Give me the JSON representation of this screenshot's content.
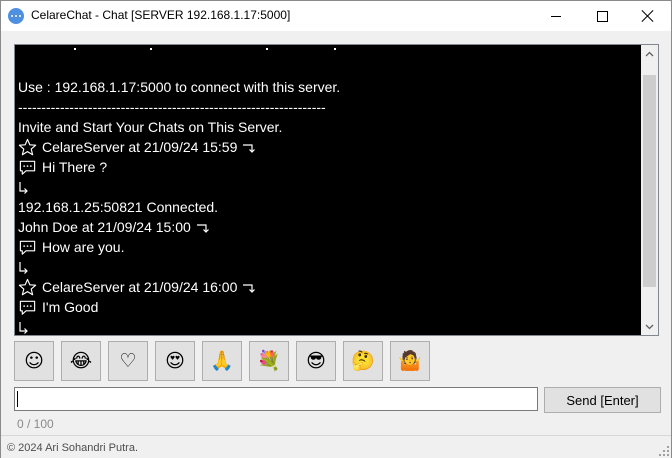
{
  "window": {
    "title": "CelareChat - Chat [SERVER 192.168.1.17:5000]"
  },
  "chat": {
    "lines": [
      {
        "icon": "",
        "text": "",
        "partial": true
      },
      {
        "icon": "",
        "text": ""
      },
      {
        "icon": "",
        "text": "Use : 192.168.1.17:5000 to connect with this server."
      },
      {
        "icon": "",
        "text": "------------------------------------------------------------------"
      },
      {
        "icon": "",
        "text": "Invite and Start Your Chats on This Server."
      },
      {
        "icon": "star-icon",
        "text": "CelareServer at 21/09/24 15:59",
        "return": true
      },
      {
        "icon": "speech-bubble-icon",
        "text": "Hi There ?"
      },
      {
        "icon": "reply-arrow-icon",
        "text": ""
      },
      {
        "icon": "",
        "text": "192.168.1.25:50821 Connected."
      },
      {
        "icon": "",
        "text": "John Doe at 21/09/24 15:00",
        "return": true
      },
      {
        "icon": "speech-bubble-icon",
        "text": "How are you."
      },
      {
        "icon": "reply-arrow-icon",
        "text": ""
      },
      {
        "icon": "star-icon",
        "text": "CelareServer at 21/09/24 16:00",
        "return": true
      },
      {
        "icon": "speech-bubble-icon",
        "text": "I'm Good"
      },
      {
        "icon": "reply-arrow-icon",
        "text": ""
      }
    ]
  },
  "emoji_buttons": [
    {
      "glyph": "☺",
      "name": "smiling-face-emoji-button"
    },
    {
      "glyph": "😂",
      "name": "tears-of-joy-emoji-button"
    },
    {
      "glyph": "♡",
      "name": "heart-emoji-button"
    },
    {
      "glyph": "😍",
      "name": "heart-eyes-emoji-button"
    },
    {
      "glyph": "🙏",
      "name": "folded-hands-emoji-button"
    },
    {
      "glyph": "💐",
      "name": "bouquet-emoji-button"
    },
    {
      "glyph": "😎",
      "name": "sunglasses-emoji-button"
    },
    {
      "glyph": "🤔",
      "name": "thinking-face-emoji-button"
    },
    {
      "glyph": "🤷",
      "name": "shrug-emoji-button"
    }
  ],
  "input": {
    "value": "",
    "placeholder": ""
  },
  "send_label": "Send [Enter]",
  "char_counter": "0 / 100",
  "status": {
    "copyright": "© 2024 Ari Sohandri Putra."
  },
  "colors": {
    "chat_bg": "#000000",
    "chat_text": "#ffffff",
    "app_icon": "#4e8fe0"
  }
}
